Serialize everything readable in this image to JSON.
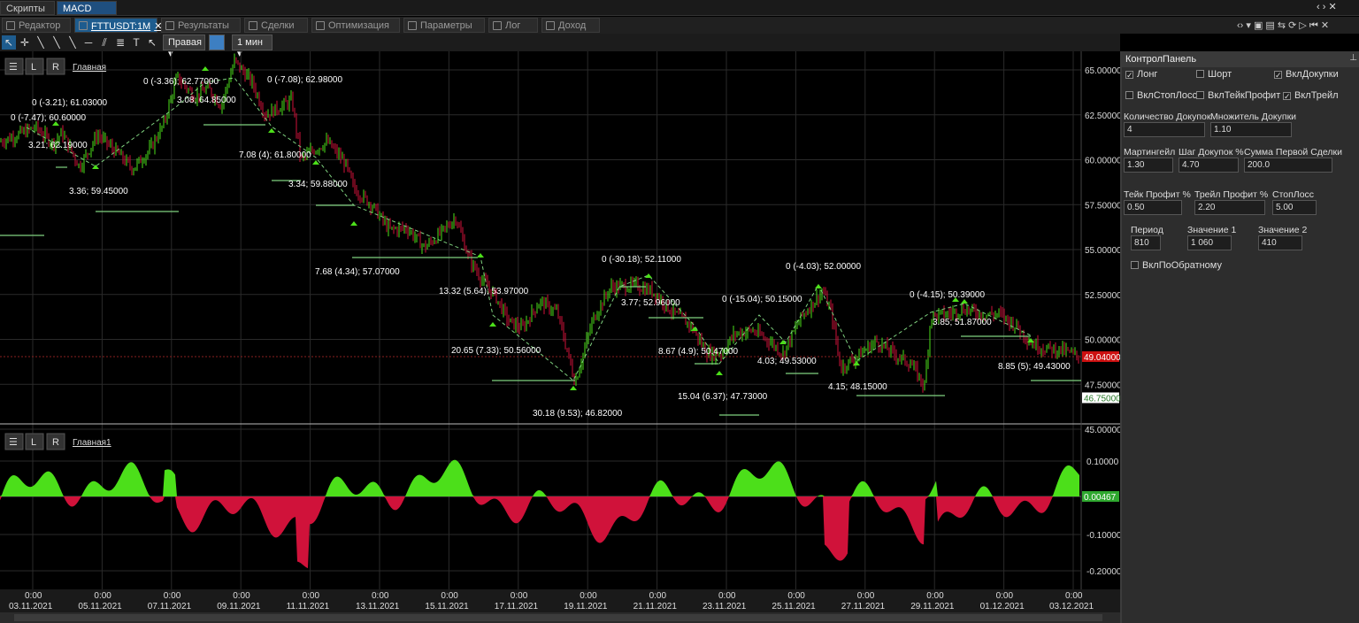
{
  "window_tabs": [
    {
      "label": "Скрипты",
      "active": false
    },
    {
      "label": "MACD",
      "active": true
    }
  ],
  "doc_tabs": [
    {
      "label": "Редактор",
      "active": false
    },
    {
      "label": "FTTUSDT:1M",
      "active": true
    },
    {
      "label": "Результаты",
      "active": false
    },
    {
      "label": "Сделки",
      "active": false
    },
    {
      "label": "Оптимизация",
      "active": false
    },
    {
      "label": "Параметры",
      "active": false
    },
    {
      "label": "Лог",
      "active": false
    },
    {
      "label": "Доход",
      "active": false
    }
  ],
  "toolbar": {
    "axis_side": "Правая",
    "timeframe": "1 мин"
  },
  "main_pane": {
    "title": "Главная",
    "btn_l": "L",
    "btn_r": "R",
    "price_labels": [
      "65.00000",
      "62.50000",
      "60.00000",
      "57.50000",
      "55.00000",
      "52.50000",
      "50.00000",
      "47.50000",
      "45.00000"
    ],
    "current_price": "49.04000",
    "marker_price": "46.75000",
    "annotations": [
      "0 (-7.47); 60.60000",
      "0 (-3.21); 61.03000",
      "3.21; 62.19000",
      "3.36; 59.45000",
      "0 (-3.36); 62.77000",
      "3.08; 64.85000",
      "0 (-7.08); 62.98000",
      "7.08 (4); 61.80000",
      "3.34; 59.88000",
      "7.68 (4.34); 57.07000",
      "13.32 (5.64); 53.97000",
      "20.65 (7.33); 50.56000",
      "30.18 (9.53); 46.82000",
      "0 (-30.18); 52.11000",
      "3.77; 52.96000",
      "8.67 (4.9); 50.47000",
      "0 (-15.04); 50.15000",
      "15.04 (6.37); 47.73000",
      "4.03; 49.53000",
      "0 (-4.03); 52.00000",
      "4.15; 48.15000",
      "0 (-4.15); 50.39000",
      "3.85; 51.87000",
      "8.85 (5); 49.43000"
    ]
  },
  "osc_pane": {
    "title": "Главная1",
    "btn_l": "L",
    "btn_r": "R",
    "labels": [
      "0.10000",
      "-0.10000",
      "-0.20000"
    ],
    "current": "0.00467"
  },
  "time_axis": [
    "03.11.2021",
    "05.11.2021",
    "07.11.2021",
    "09.11.2021",
    "11.11.2021",
    "13.11.2021",
    "15.11.2021",
    "17.11.2021",
    "19.11.2021",
    "21.11.2021",
    "23.11.2021",
    "25.11.2021",
    "27.11.2021",
    "29.11.2021",
    "01.12.2021",
    "03.12.2021"
  ],
  "time_top": "0:00",
  "panel": {
    "title": "КонтролПанель",
    "checks": [
      {
        "label": "Лонг",
        "checked": true
      },
      {
        "label": "Шорт",
        "checked": false
      },
      {
        "label": "ВклДокупки",
        "checked": true
      },
      {
        "label": "ВклСтопЛосс",
        "checked": false
      },
      {
        "label": "ВклТейкПрофит",
        "checked": false
      },
      {
        "label": "ВклТрейл",
        "checked": true
      },
      {
        "label": "ВклПоОбратному",
        "checked": false
      }
    ],
    "fields": [
      {
        "label": "Количество Докупок",
        "value": "4"
      },
      {
        "label": "Множитель Докупки",
        "value": "1.10"
      },
      {
        "label": "Мартингейл",
        "value": "1.30"
      },
      {
        "label": "Шаг Докупок %",
        "value": "4.70"
      },
      {
        "label": "Сумма Первой Сделки",
        "value": "200.0"
      },
      {
        "label": "Тейк Профит %",
        "value": "0.50"
      },
      {
        "label": "Трейл Профит %",
        "value": "2.20"
      },
      {
        "label": "СтопЛосс",
        "value": "5.00"
      },
      {
        "label": "Период",
        "value": "810"
      },
      {
        "label": "Значение 1",
        "value": "1 060"
      },
      {
        "label": "Значение 2",
        "value": "410"
      }
    ]
  },
  "colors": {
    "bull": "#4cdf1a",
    "bear": "#d0123a",
    "accent": "#1e5c8e",
    "trade_line": "#7fd17f",
    "price_tag": "#cc1010"
  }
}
